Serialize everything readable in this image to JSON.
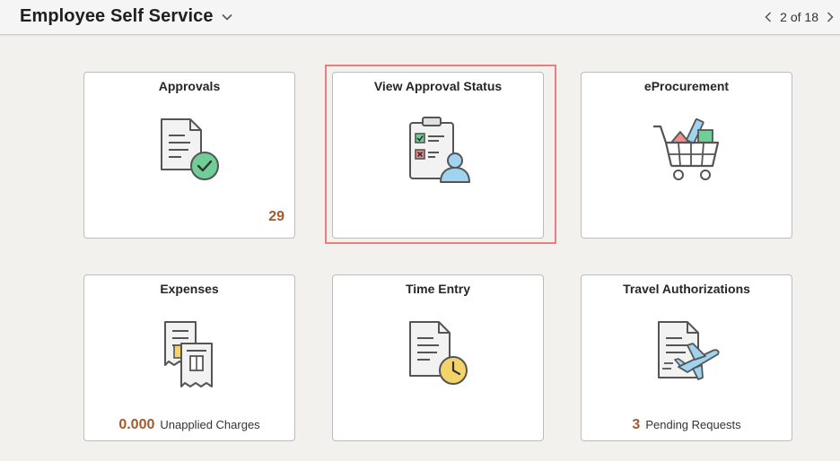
{
  "header": {
    "title": "Employee Self Service",
    "pager_text": "2 of 18"
  },
  "colors": {
    "accent_number": "#a35a2c",
    "focus_ring": "#e87e7e"
  },
  "tiles": [
    {
      "title": "Approvals",
      "icon": "document-check-icon",
      "count": "29"
    },
    {
      "title": "View Approval Status",
      "icon": "clipboard-user-icon",
      "focused": true
    },
    {
      "title": "eProcurement",
      "icon": "shopping-cart-icon"
    },
    {
      "title": "Expenses",
      "icon": "receipts-icon",
      "footer_value": "0.000",
      "footer_label": "Unapplied Charges"
    },
    {
      "title": "Time Entry",
      "icon": "document-clock-icon"
    },
    {
      "title": "Travel Authorizations",
      "icon": "document-airplane-icon",
      "footer_value": "3",
      "footer_label": "Pending Requests"
    }
  ]
}
